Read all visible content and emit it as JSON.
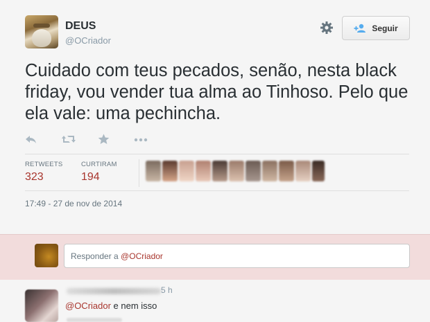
{
  "tweet": {
    "author_name": "DEUS",
    "author_handle": "@OCriador",
    "follow_label": "Seguir",
    "text": "Cuidado com teus pecados, senão, nesta black friday, vou vender tua alma ao Tinhoso. Pelo que ela vale: uma pechincha.",
    "stats": {
      "retweets_label": "RETWEETS",
      "retweets_count": "323",
      "favorites_label": "CURTIRAM",
      "favorites_count": "194"
    },
    "timestamp": "17:49 - 27 de nov de 2014",
    "favoriters_count_shown": 11
  },
  "reply_box": {
    "prefix": "Responder a ",
    "mention": "@OCriador"
  },
  "reply": {
    "time": "5 h",
    "mention": "@OCriador",
    "text": " e nem isso"
  },
  "colors": {
    "accent": "#a8352d",
    "muted": "#8899a6",
    "reply_bar_bg": "#f2dcdc"
  },
  "icons": [
    "reply-icon",
    "retweet-icon",
    "favorite-icon",
    "more-icon",
    "gear-icon",
    "follow-user-icon"
  ]
}
